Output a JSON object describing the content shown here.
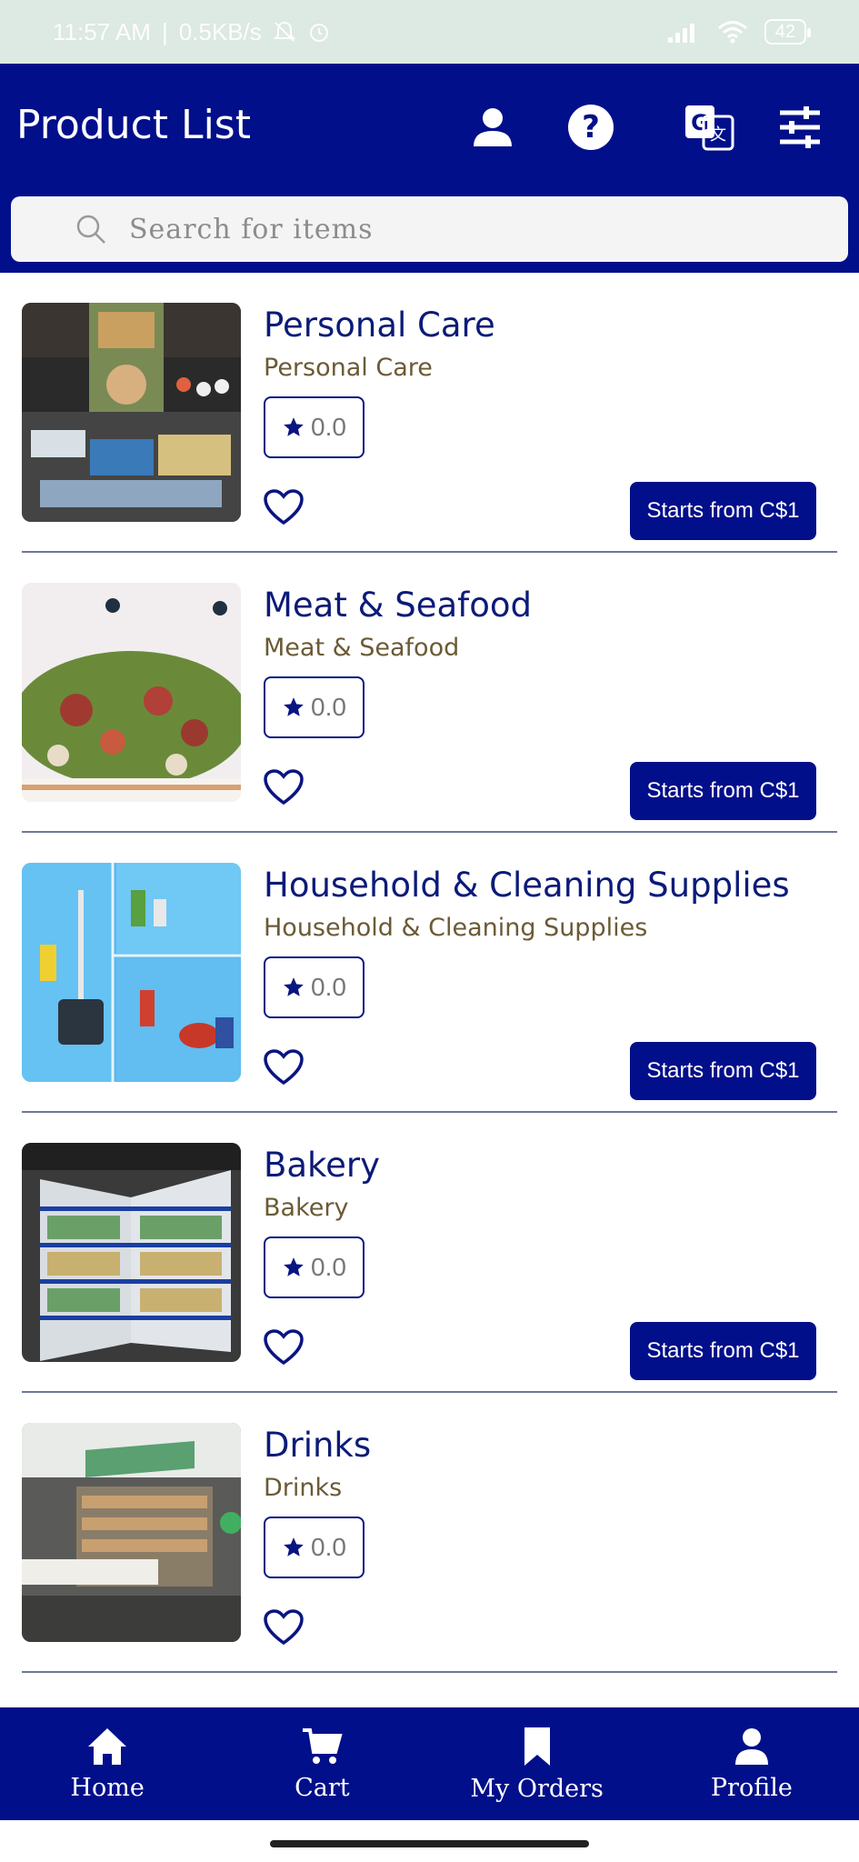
{
  "status_bar": {
    "time": "11:57 AM",
    "speed": "0.5KB/s",
    "battery": "42"
  },
  "header": {
    "title": "Product List"
  },
  "search": {
    "placeholder": "Search for items"
  },
  "products": [
    {
      "title": "Personal Care",
      "category": "Personal Care",
      "rating": "0.0",
      "price": "Starts from C$1"
    },
    {
      "title": "Meat & Seafood",
      "category": "Meat & Seafood",
      "rating": "0.0",
      "price": "Starts from C$1"
    },
    {
      "title": "Household & Cleaning Supplies",
      "category": "Household & Cleaning Supplies",
      "rating": "0.0",
      "price": "Starts from C$1"
    },
    {
      "title": "Bakery",
      "category": "Bakery",
      "rating": "0.0",
      "price": "Starts from C$1"
    },
    {
      "title": "Drinks",
      "category": "Drinks",
      "rating": "0.0",
      "price": ""
    }
  ],
  "bottom_nav": {
    "home": "Home",
    "cart": "Cart",
    "orders": "My Orders",
    "profile": "Profile"
  },
  "colors": {
    "brand": "#020f8a",
    "title_text": "#0c1b78",
    "category_text": "#6b5a35"
  }
}
